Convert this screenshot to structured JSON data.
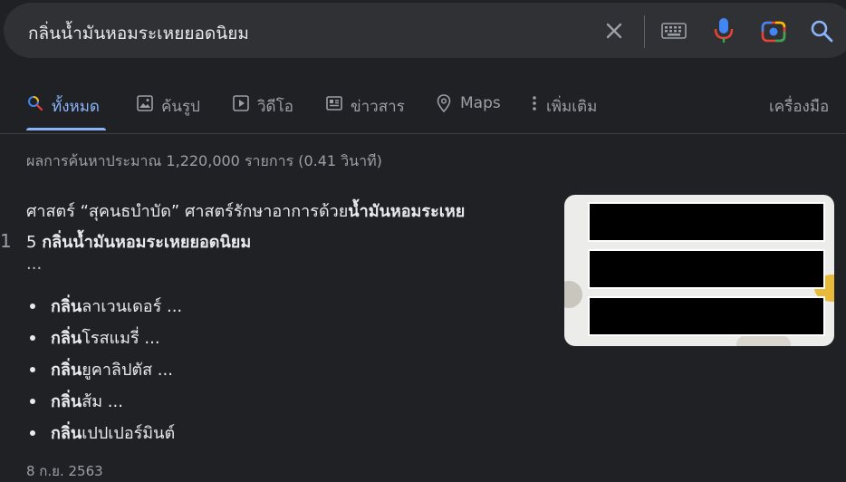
{
  "search": {
    "query": "กลิ่นน้ำมันหอมระเหยยอดนิยม",
    "icons": [
      "close-icon",
      "keyboard-icon",
      "microphone-icon",
      "camera-icon",
      "search-icon"
    ]
  },
  "tabs": [
    {
      "label": "ทั้งหมด",
      "icon": "search-icon",
      "active": true
    },
    {
      "label": "ค้นรูป",
      "icon": "image-icon"
    },
    {
      "label": "วิดีโอ",
      "icon": "play-icon"
    },
    {
      "label": "ข่าวสาร",
      "icon": "news-icon"
    },
    {
      "label": "Maps",
      "icon": "map-pin-icon"
    },
    {
      "label": "เพิ่มเติม",
      "icon": "more-vert-icon"
    }
  ],
  "tools_label": "เครื่องมือ",
  "stats": "ผลการค้นหาประมาณ 1,220,000 รายการ (0.41 วินาที)",
  "result": {
    "left_marker": "1",
    "line1_plain": "ศาสตร์ “สุคนธบำบัด” ศาสตร์รักษาอาการด้วย",
    "line1_bold": "น้ำมันหอมระเหย",
    "line2_plain": "5 ",
    "line2_bold": "กลิ่นน้ำมันหอมระเหยยอดนิยม",
    "ellipsis": "...",
    "bullets": [
      {
        "bold": "กลิ่น",
        "rest": "ลาเวนเดอร์ ..."
      },
      {
        "bold": "กลิ่น",
        "rest": "โรสแมรี่ ..."
      },
      {
        "bold": "กลิ่น",
        "rest": "ยูคาลิปตัส ..."
      },
      {
        "bold": "กลิ่น",
        "rest": "ส้ม ..."
      },
      {
        "bold": "กลิ่น",
        "rest": "เปปเปอร์มินต์"
      }
    ],
    "date": "8 ก.ย. 2563"
  }
}
